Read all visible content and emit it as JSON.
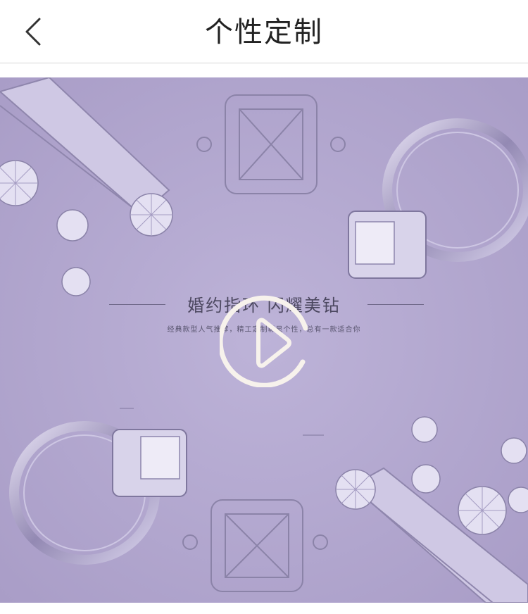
{
  "header": {
    "title": "个性定制",
    "back_icon": "chevron-left-icon"
  },
  "media": {
    "headline": "婚约指环  闪耀美钻",
    "subline": "经典款型人气推荐，精工定制彰显个性，总有一款适合你",
    "play_icon": "play-circle-icon",
    "colors": {
      "background": "#b3a8cf",
      "play": "#f7f2ec"
    }
  }
}
